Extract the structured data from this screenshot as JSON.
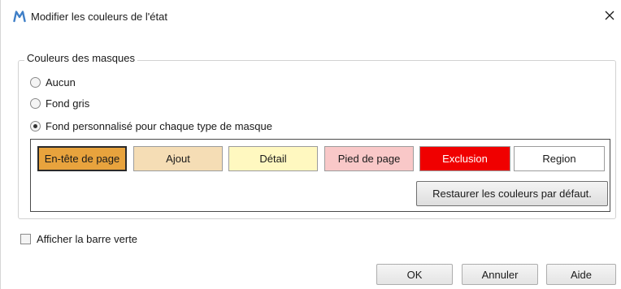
{
  "window": {
    "title": "Modifier les couleurs de l'état",
    "app_icon": "m-logo-icon",
    "close_icon": "close-icon",
    "accent_color": "#3f7fc7"
  },
  "mask_colors": {
    "group_label": "Couleurs des masques",
    "options": [
      {
        "label": "Aucun",
        "checked": false
      },
      {
        "label": "Fond gris",
        "checked": false
      },
      {
        "label": "Fond personnalisé pour chaque type de masque",
        "checked": true
      }
    ],
    "swatches": [
      {
        "label": "En-tête de page",
        "bg": "#e8a33d",
        "fg": "#1a1a1a",
        "selected": true
      },
      {
        "label": "Ajout",
        "bg": "#f5ddb5",
        "fg": "#1a1a1a",
        "selected": false
      },
      {
        "label": "Détail",
        "bg": "#fff8c0",
        "fg": "#1a1a1a",
        "selected": false
      },
      {
        "label": "Pied de page",
        "bg": "#f9c8c8",
        "fg": "#1a1a1a",
        "selected": false
      },
      {
        "label": "Exclusion",
        "bg": "#f00000",
        "fg": "#ffffff",
        "selected": false
      },
      {
        "label": "Region",
        "bg": "#ffffff",
        "fg": "#1a1a1a",
        "selected": false
      }
    ],
    "restore_label": "Restaurer les couleurs par défaut."
  },
  "green_bar": {
    "label": "Afficher la barre verte",
    "checked": false
  },
  "footer": {
    "ok_label": "OK",
    "cancel_label": "Annuler",
    "help_label": "Aide"
  }
}
